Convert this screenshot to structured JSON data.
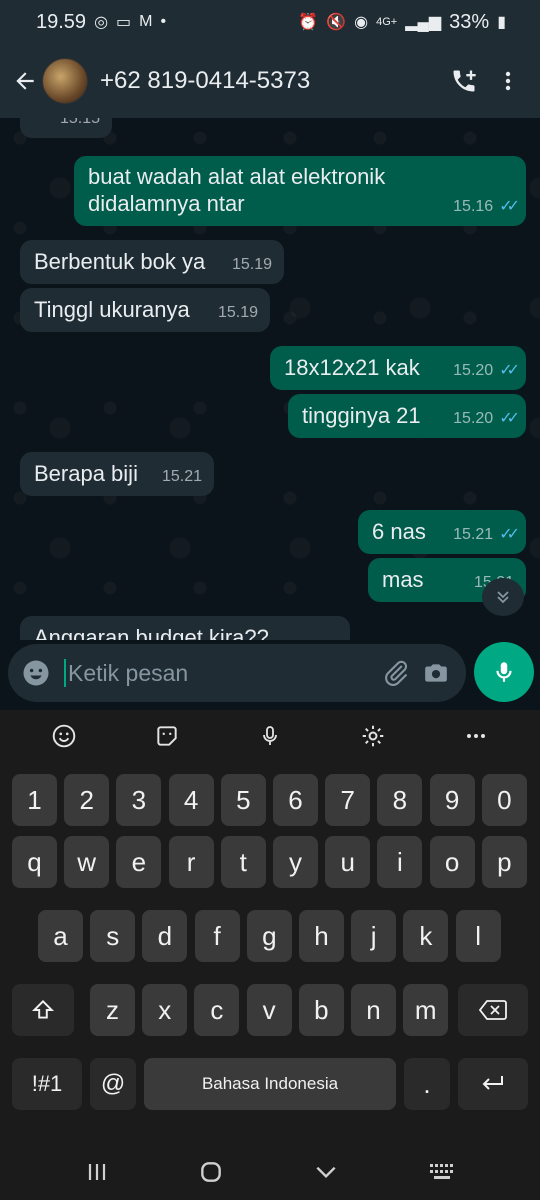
{
  "status_bar": {
    "time": "19.59",
    "network": "4G+",
    "battery": "33%"
  },
  "header": {
    "contact": "+62 819-0414-5373"
  },
  "messages": [
    {
      "dir": "in",
      "text": "",
      "time": "15.15",
      "partial": true
    },
    {
      "dir": "out",
      "text": "buat wadah alat alat elektronik\ndidalamnya ntar",
      "time": "15.16",
      "read": true
    },
    {
      "dir": "in",
      "text": "Berbentuk bok ya",
      "time": "15.19"
    },
    {
      "dir": "in",
      "text": "Tinggl ukuranya",
      "time": "15.19"
    },
    {
      "dir": "out",
      "text": "18x12x21 kak",
      "time": "15.20",
      "read": true
    },
    {
      "dir": "out",
      "text": "tingginya 21",
      "time": "15.20",
      "read": true
    },
    {
      "dir": "in",
      "text": "Berapa biji",
      "time": "15.21"
    },
    {
      "dir": "out",
      "text": "6 nas",
      "time": "15.21",
      "read": true
    },
    {
      "dir": "out",
      "text": "mas",
      "time": "15.21",
      "read": true
    },
    {
      "dir": "in",
      "text": "Anggaran budget kira??",
      "time": "",
      "partial": true
    }
  ],
  "composer": {
    "placeholder": "Ketik pesan"
  },
  "keyboard": {
    "row_numbers": [
      "1",
      "2",
      "3",
      "4",
      "5",
      "6",
      "7",
      "8",
      "9",
      "0"
    ],
    "row_top": [
      "q",
      "w",
      "e",
      "r",
      "t",
      "y",
      "u",
      "i",
      "o",
      "p"
    ],
    "row_mid": [
      "a",
      "s",
      "d",
      "f",
      "g",
      "h",
      "j",
      "k",
      "l"
    ],
    "row_bot": [
      "z",
      "x",
      "c",
      "v",
      "b",
      "n",
      "m"
    ],
    "symbols_key": "!#1",
    "at_key": "@",
    "space_label": "Bahasa Indonesia",
    "period_key": "."
  },
  "colors": {
    "outgoing_bubble": "#005c4b",
    "incoming_bubble": "#1f2c34",
    "accent": "#00a884",
    "read_tick": "#53bdeb"
  }
}
